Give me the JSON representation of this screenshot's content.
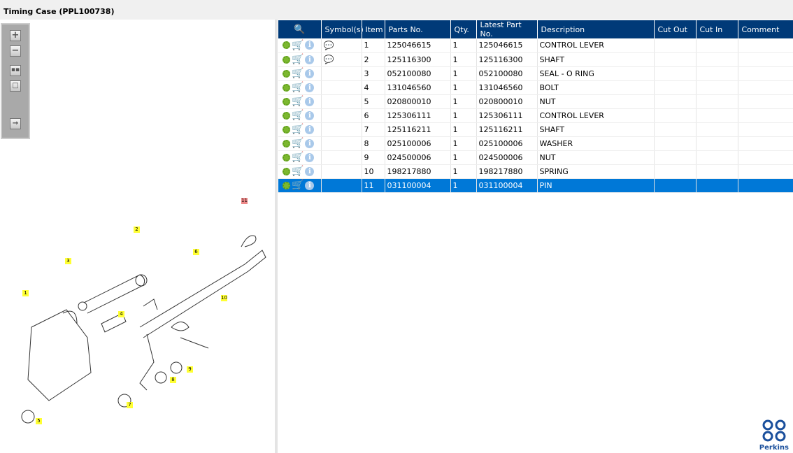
{
  "title": "Timing Case (PPL100738)",
  "toolbar": [
    "zoom-in",
    "zoom-out",
    "fit-all",
    "fit-window",
    "export"
  ],
  "columns": [
    "Symbol(s)",
    "Item",
    "Parts No.",
    "Qty.",
    "Latest Part No.",
    "Description",
    "Cut Out",
    "Cut In",
    "Comment"
  ],
  "rows": [
    {
      "symbol": true,
      "item": "1",
      "part": "125046615",
      "qty": "1",
      "latest": "125046615",
      "desc": "CONTROL LEVER"
    },
    {
      "symbol": true,
      "item": "2",
      "part": "125116300",
      "qty": "1",
      "latest": "125116300",
      "desc": "SHAFT"
    },
    {
      "symbol": false,
      "item": "3",
      "part": "052100080",
      "qty": "1",
      "latest": "052100080",
      "desc": "SEAL - O RING"
    },
    {
      "symbol": false,
      "item": "4",
      "part": "131046560",
      "qty": "1",
      "latest": "131046560",
      "desc": "BOLT"
    },
    {
      "symbol": false,
      "item": "5",
      "part": "020800010",
      "qty": "1",
      "latest": "020800010",
      "desc": "NUT"
    },
    {
      "symbol": false,
      "item": "6",
      "part": "125306111",
      "qty": "1",
      "latest": "125306111",
      "desc": "CONTROL LEVER"
    },
    {
      "symbol": false,
      "item": "7",
      "part": "125116211",
      "qty": "1",
      "latest": "125116211",
      "desc": "SHAFT"
    },
    {
      "symbol": false,
      "item": "8",
      "part": "025100006",
      "qty": "1",
      "latest": "025100006",
      "desc": "WASHER"
    },
    {
      "symbol": false,
      "item": "9",
      "part": "024500006",
      "qty": "1",
      "latest": "024500006",
      "desc": "NUT"
    },
    {
      "symbol": false,
      "item": "10",
      "part": "198217880",
      "qty": "1",
      "latest": "198217880",
      "desc": "SPRING"
    },
    {
      "symbol": false,
      "item": "11",
      "part": "031100004",
      "qty": "1",
      "latest": "031100004",
      "desc": "PIN",
      "selected": true
    }
  ],
  "callouts": [
    "1",
    "2",
    "3",
    "4",
    "5",
    "6",
    "7",
    "8",
    "9",
    "10",
    "11"
  ],
  "logo": "Perkins",
  "colors": {
    "header": "#003a78",
    "selected": "#0078d7",
    "callout": "#ffff33"
  }
}
